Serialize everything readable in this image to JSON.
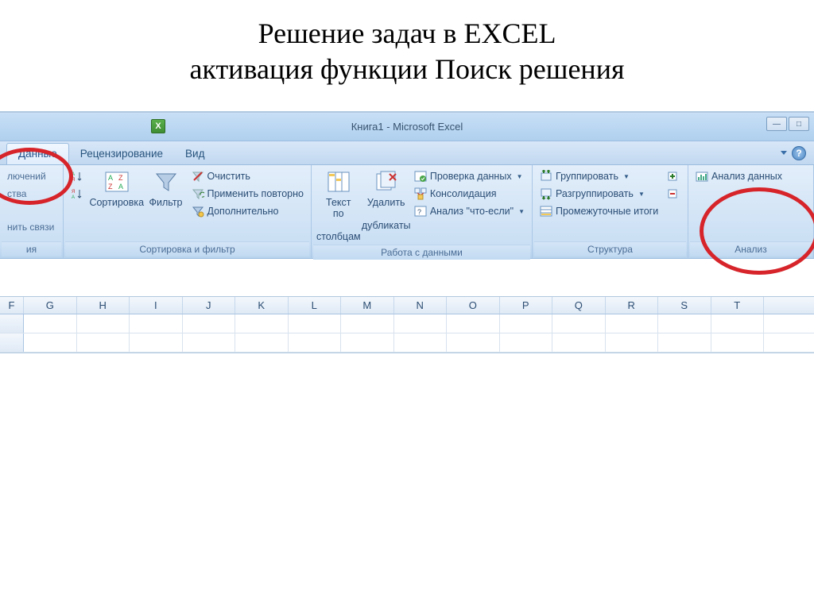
{
  "slide": {
    "title_line1": "Решение задач в EXCEL",
    "title_line2": "активация функции Поиск решения"
  },
  "titlebar": {
    "document": "Книга1 - Microsoft Excel"
  },
  "tabs": {
    "data": "Данные",
    "review": "Рецензирование",
    "view": "Вид"
  },
  "group_connections": {
    "label": "ия",
    "item_connections": "лючений",
    "item_properties": "ства",
    "item_links": "нить связи"
  },
  "group_sort": {
    "label": "Сортировка и фильтр",
    "sort_btn": "Сортировка",
    "filter_btn": "Фильтр",
    "clear": "Очистить",
    "reapply": "Применить повторно",
    "advanced": "Дополнительно"
  },
  "group_datatools": {
    "label": "Работа с данными",
    "text_to_cols_l1": "Текст по",
    "text_to_cols_l2": "столбцам",
    "remove_dup_l1": "Удалить",
    "remove_dup_l2": "дубликаты",
    "validation": "Проверка данных",
    "consolidate": "Консолидация",
    "whatif": "Анализ \"что-если\""
  },
  "group_outline": {
    "label": "Структура",
    "group": "Группировать",
    "ungroup": "Разгруппировать",
    "subtotal": "Промежуточные итоги"
  },
  "group_analysis": {
    "label": "Анализ",
    "data_analysis": "Анализ данных"
  },
  "columns": [
    "F",
    "G",
    "H",
    "I",
    "J",
    "K",
    "L",
    "M",
    "N",
    "O",
    "P",
    "Q",
    "R",
    "S",
    "T"
  ]
}
